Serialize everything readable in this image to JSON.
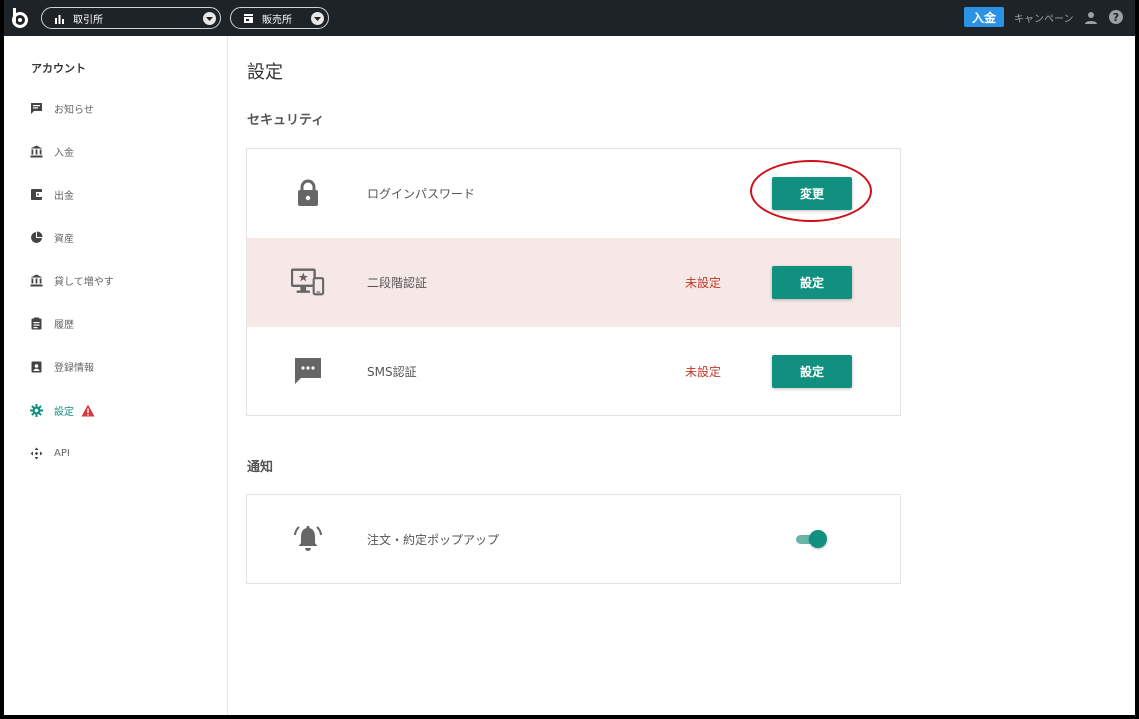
{
  "topbar": {
    "exchange_label": "取引所",
    "sales_label": "販売所",
    "deposit_label": "入金",
    "campaign_label": "キャンペーン"
  },
  "sidebar": {
    "title": "アカウント",
    "items": [
      {
        "label": "お知らせ",
        "icon": "message-icon"
      },
      {
        "label": "入金",
        "icon": "bank-icon"
      },
      {
        "label": "出金",
        "icon": "wallet-icon"
      },
      {
        "label": "資産",
        "icon": "pie-chart-icon"
      },
      {
        "label": "貸して増やす",
        "icon": "bank-icon"
      },
      {
        "label": "履歴",
        "icon": "clipboard-icon"
      },
      {
        "label": "登録情報",
        "icon": "account-box-icon"
      },
      {
        "label": "設定",
        "icon": "gear-icon",
        "active": true,
        "warning": true
      },
      {
        "label": "API",
        "icon": "api-icon"
      }
    ]
  },
  "main": {
    "title": "設定",
    "security": {
      "title": "セキュリティ",
      "rows": [
        {
          "label": "ログインパスワード",
          "status": "",
          "button": "変更",
          "icon": "lock-icon"
        },
        {
          "label": "二段階認証",
          "status": "未設定",
          "button": "設定",
          "icon": "devices-icon"
        },
        {
          "label": "SMS認証",
          "status": "未設定",
          "button": "設定",
          "icon": "sms-icon"
        }
      ]
    },
    "notification": {
      "title": "通知",
      "rows": [
        {
          "label": "注文・約定ポップアップ",
          "toggle_on": true,
          "icon": "bell-ringing-icon"
        }
      ]
    }
  },
  "colors": {
    "accent": "#12907f",
    "alert_row": "#f6e8e6",
    "status_unset": "#c0392b",
    "deposit_button": "#2a93e6",
    "topbar": "#1e2328",
    "highlight": "#d0101a"
  }
}
